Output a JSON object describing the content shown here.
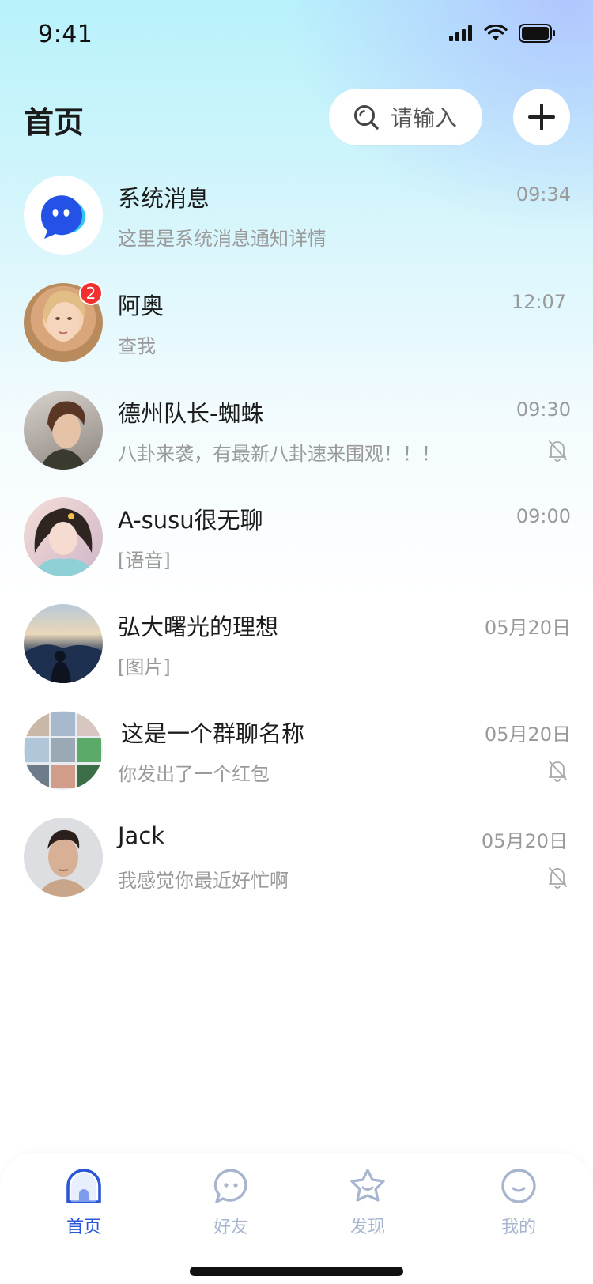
{
  "status_bar": {
    "time": "9:41"
  },
  "header": {
    "title": "首页"
  },
  "search": {
    "placeholder": "请输入"
  },
  "colors": {
    "accent": "#2a57d8",
    "badge": "#f23030",
    "inactive_tab": "#a7b5cf"
  },
  "chats": [
    {
      "name": "系统消息",
      "time": "09:34",
      "preview": "这里是系统消息通知详情",
      "avatar": "system-bot-avatar",
      "muted": false
    },
    {
      "name": "阿奥",
      "time": "12:07",
      "preview": "查我",
      "avatar": "user-avatar",
      "badge": "2",
      "muted": false
    },
    {
      "name": "德州队长-蜘蛛",
      "time": "09:30",
      "preview": "八卦来袭，有最新八卦速来围观！！！",
      "avatar": "user-avatar",
      "muted": true
    },
    {
      "name": "A-susu很无聊",
      "time": "09:00",
      "preview": "[语音]",
      "avatar": "user-avatar",
      "muted": false
    },
    {
      "name": "弘大曙光的理想",
      "time": "05月20日",
      "preview": "[图片]",
      "avatar": "user-avatar",
      "muted": false
    },
    {
      "name": "这是一个群聊名称",
      "time": "05月20日",
      "preview": "你发出了一个红包",
      "avatar": "group-avatar",
      "muted": true
    },
    {
      "name": "Jack",
      "time": "05月20日",
      "preview": "我感觉你最近好忙啊",
      "avatar": "user-avatar",
      "muted": true
    }
  ],
  "tabs": [
    {
      "label": "首页",
      "icon": "home-icon",
      "active": true
    },
    {
      "label": "好友",
      "icon": "chat-bubble-icon",
      "active": false
    },
    {
      "label": "发现",
      "icon": "star-icon",
      "active": false
    },
    {
      "label": "我的",
      "icon": "smile-icon",
      "active": false
    }
  ]
}
